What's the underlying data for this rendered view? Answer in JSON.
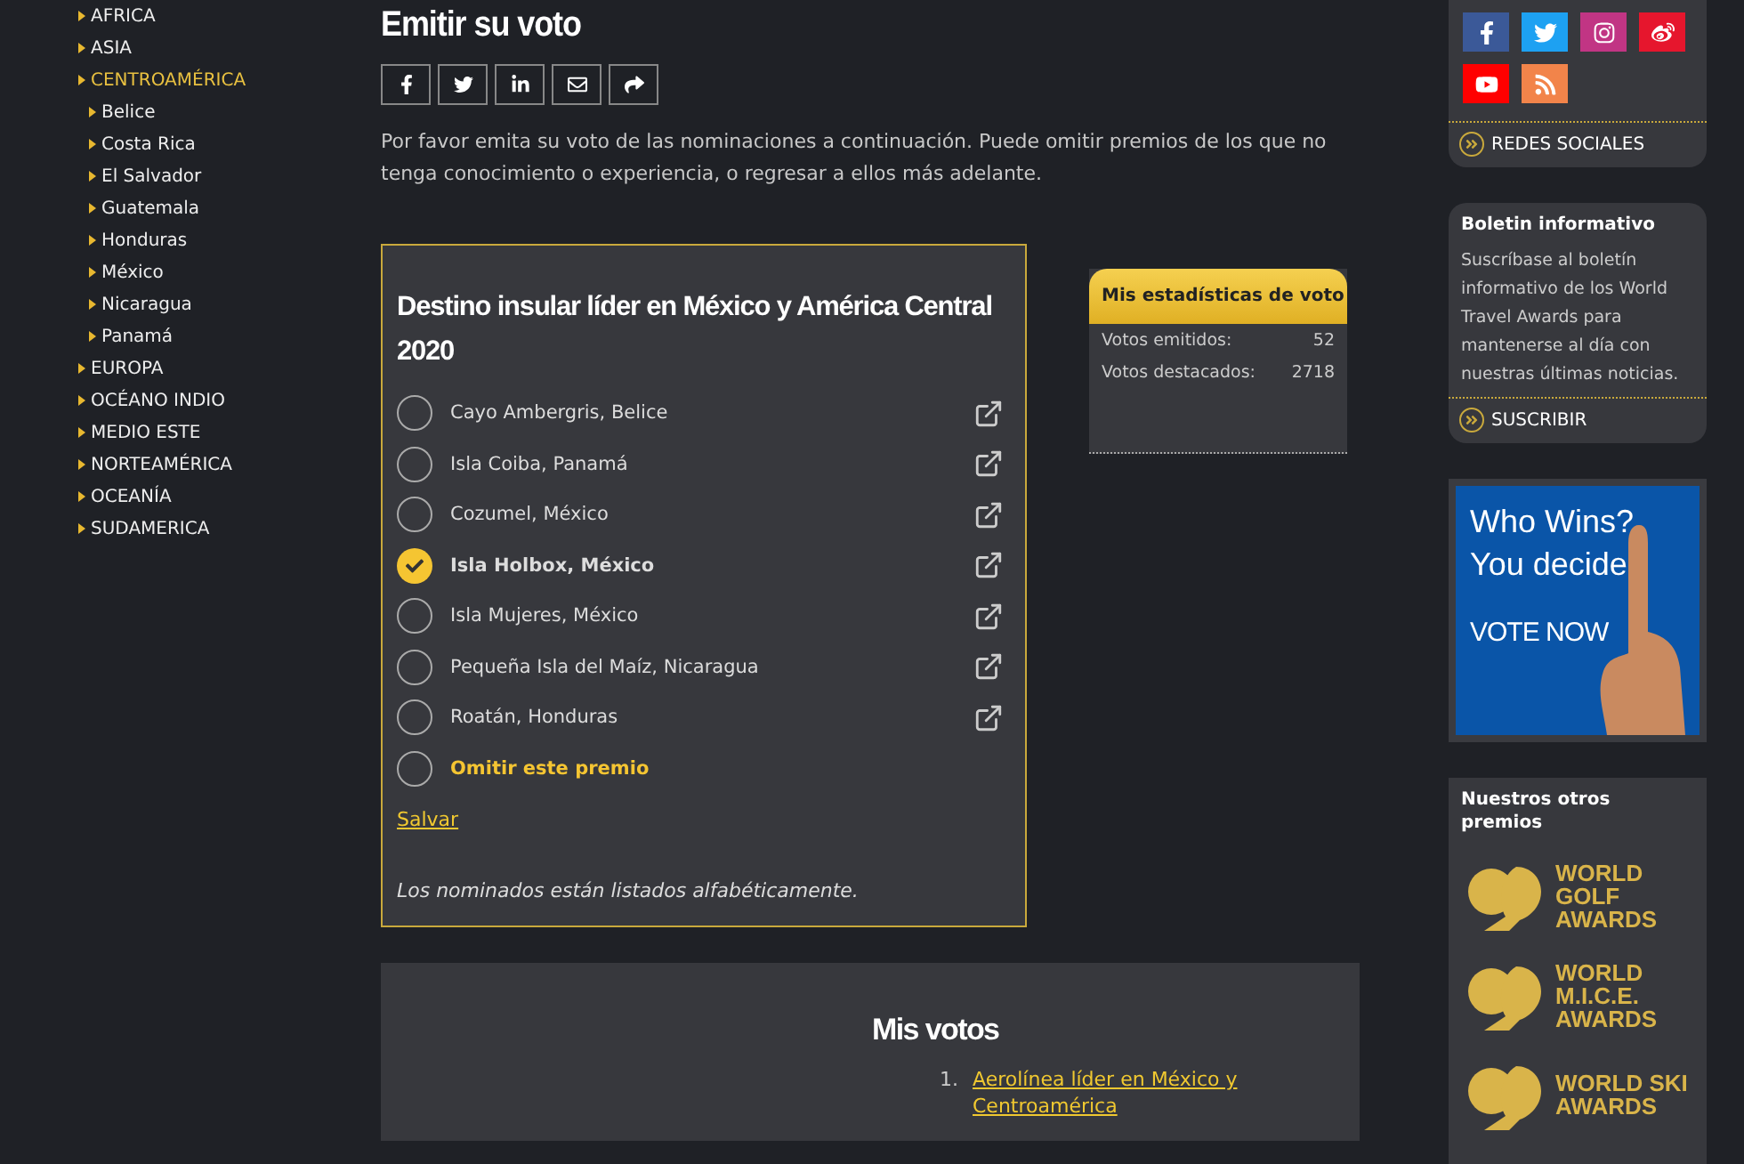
{
  "region_nav": {
    "items": [
      {
        "label": "AFRICA",
        "selected": false
      },
      {
        "label": "ASIA",
        "selected": false
      },
      {
        "label": "CENTROAMÉRICA",
        "selected": true,
        "children": [
          {
            "label": "Belice"
          },
          {
            "label": "Costa Rica"
          },
          {
            "label": "El Salvador"
          },
          {
            "label": "Guatemala"
          },
          {
            "label": "Honduras"
          },
          {
            "label": "México"
          },
          {
            "label": "Nicaragua"
          },
          {
            "label": "Panamá"
          }
        ]
      },
      {
        "label": "EUROPA",
        "selected": false
      },
      {
        "label": "OCÉANO INDIO",
        "selected": false
      },
      {
        "label": "MEDIO ESTE",
        "selected": false
      },
      {
        "label": "NORTEAMÉRICA",
        "selected": false
      },
      {
        "label": "OCEANÍA",
        "selected": false
      },
      {
        "label": "SUDAMERICA",
        "selected": false
      }
    ]
  },
  "page_title": "Emitir su voto",
  "share_buttons": [
    {
      "kind": "facebook"
    },
    {
      "kind": "twitter"
    },
    {
      "kind": "linkedin"
    },
    {
      "kind": "email"
    },
    {
      "kind": "share"
    }
  ],
  "intro": "Por favor emita su voto de las nominaciones a continuación. Puede omitir premios de los que no tenga conocimiento o experiencia, o regresar a ellos más adelante.",
  "ballot": {
    "title": "Destino insular líder en México y América Central 2020",
    "options": [
      {
        "kind": "nominee",
        "label": "Cayo Ambergris, Belice",
        "selected": false
      },
      {
        "kind": "nominee",
        "label": "Isla Coiba, Panamá",
        "selected": false
      },
      {
        "kind": "nominee",
        "label": "Cozumel, México",
        "selected": false
      },
      {
        "kind": "nominee",
        "label": "Isla Holbox, México",
        "selected": true
      },
      {
        "kind": "nominee",
        "label": "Isla Mujeres, México",
        "selected": false
      },
      {
        "kind": "nominee",
        "label": "Pequeña Isla del Maíz, Nicaragua",
        "selected": false
      },
      {
        "kind": "nominee",
        "label": "Roatán, Honduras",
        "selected": false
      },
      {
        "kind": "skip",
        "label": "Omitir este premio",
        "selected": false
      }
    ],
    "save_link": "Salvar",
    "note": "Los nominados están listados alfabéticamente."
  },
  "stats": {
    "title": "Mis estadísticas de voto",
    "rows": [
      {
        "label": "Votos emitidos:",
        "value": "52"
      },
      {
        "label": "Votos destacados:",
        "value": "2718"
      }
    ]
  },
  "my_votes": {
    "title": "Mis votos",
    "items": [
      {
        "number": "1.",
        "link": "Aerolínea líder en México y Centroamérica"
      }
    ]
  },
  "social": {
    "icons": [
      {
        "kind": "facebook",
        "color": "#3b5998"
      },
      {
        "kind": "twitter",
        "color": "#1da1f2"
      },
      {
        "kind": "instagram",
        "color": "#c13584"
      },
      {
        "kind": "weibo",
        "color": "#e6162d"
      },
      {
        "kind": "youtube",
        "color": "#ff0000"
      },
      {
        "kind": "rss",
        "color": "#f2844a"
      }
    ],
    "link": "REDES SOCIALES"
  },
  "newsletter": {
    "title": "Boletin informativo",
    "text": "Suscríbase al boletín informativo de los World Travel Awards para mantenerse al día con nuestras últimas noticias.",
    "link": "SUSCRIBIR"
  },
  "banner": {
    "line_1": "Who Wins?",
    "line_2": "You decide",
    "cta": "VOTE NOW"
  },
  "other_awards": {
    "title": "Nuestros otros premios",
    "logos": [
      {
        "lines": [
          "WORLD",
          "GOLF",
          "AWARDS"
        ]
      },
      {
        "lines": [
          "WORLD",
          "M.I.C.E.",
          "AWARDS"
        ]
      },
      {
        "lines": [
          "WORLD SKI",
          "AWARDS"
        ]
      }
    ]
  }
}
